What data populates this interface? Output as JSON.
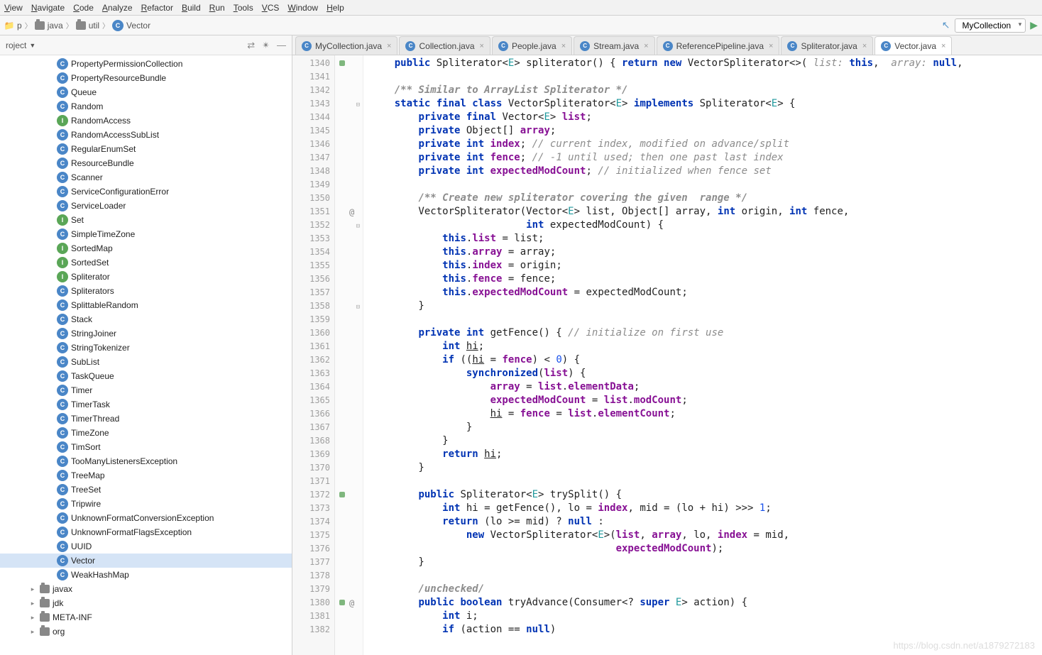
{
  "menu": [
    "View",
    "Navigate",
    "Code",
    "Analyze",
    "Refactor",
    "Build",
    "Run",
    "Tools",
    "VCS",
    "Window",
    "Help"
  ],
  "breadcrumb": {
    "p": "p",
    "java": "java",
    "util": "util",
    "vector": "Vector"
  },
  "runconfig": "MyCollection",
  "sidebar": {
    "title": "roject"
  },
  "tree": [
    {
      "t": "c",
      "n": "PropertyPermissionCollection"
    },
    {
      "t": "c",
      "n": "PropertyResourceBundle"
    },
    {
      "t": "c",
      "n": "Queue"
    },
    {
      "t": "c",
      "n": "Random"
    },
    {
      "t": "i",
      "n": "RandomAccess"
    },
    {
      "t": "c",
      "n": "RandomAccessSubList"
    },
    {
      "t": "c",
      "n": "RegularEnumSet"
    },
    {
      "t": "c",
      "n": "ResourceBundle"
    },
    {
      "t": "c",
      "n": "Scanner"
    },
    {
      "t": "c",
      "n": "ServiceConfigurationError"
    },
    {
      "t": "c",
      "n": "ServiceLoader"
    },
    {
      "t": "i",
      "n": "Set"
    },
    {
      "t": "c",
      "n": "SimpleTimeZone"
    },
    {
      "t": "i",
      "n": "SortedMap"
    },
    {
      "t": "i",
      "n": "SortedSet"
    },
    {
      "t": "i",
      "n": "Spliterator"
    },
    {
      "t": "c",
      "n": "Spliterators"
    },
    {
      "t": "c",
      "n": "SplittableRandom"
    },
    {
      "t": "c",
      "n": "Stack"
    },
    {
      "t": "c",
      "n": "StringJoiner"
    },
    {
      "t": "c",
      "n": "StringTokenizer"
    },
    {
      "t": "c",
      "n": "SubList"
    },
    {
      "t": "c",
      "n": "TaskQueue"
    },
    {
      "t": "c",
      "n": "Timer"
    },
    {
      "t": "c",
      "n": "TimerTask"
    },
    {
      "t": "c",
      "n": "TimerThread"
    },
    {
      "t": "c",
      "n": "TimeZone"
    },
    {
      "t": "c",
      "n": "TimSort"
    },
    {
      "t": "c",
      "n": "TooManyListenersException"
    },
    {
      "t": "c",
      "n": "TreeMap"
    },
    {
      "t": "c",
      "n": "TreeSet"
    },
    {
      "t": "c",
      "n": "Tripwire"
    },
    {
      "t": "c",
      "n": "UnknownFormatConversionException"
    },
    {
      "t": "c",
      "n": "UnknownFormatFlagsException"
    },
    {
      "t": "c",
      "n": "UUID"
    },
    {
      "t": "c",
      "n": "Vector",
      "sel": true
    },
    {
      "t": "c",
      "n": "WeakHashMap"
    }
  ],
  "pkgs": [
    "javax",
    "jdk",
    "META-INF",
    "org"
  ],
  "tabs": [
    {
      "n": "MyCollection.java",
      "a": false
    },
    {
      "n": "Collection.java",
      "a": false
    },
    {
      "n": "People.java",
      "a": false
    },
    {
      "n": "Stream.java",
      "a": false
    },
    {
      "n": "ReferencePipeline.java",
      "a": false
    },
    {
      "n": "Spliterator.java",
      "a": false
    },
    {
      "n": "Vector.java",
      "a": true
    }
  ],
  "startLine": 1340,
  "lines": [
    {
      "m": "g",
      "h": "    <span class='kw'>public</span> Spliterator&lt;<span class='gen'>E</span>&gt; spliterator() { <span class='kw'>return new</span> VectorSpliterator&lt;&gt;( <span class='cm'>list:</span> <span class='kw'>this</span>,  <span class='cm'>array:</span> <span class='kw'>null</span>,"
    },
    {
      "h": ""
    },
    {
      "h": "    <span class='doc'>/** Similar to ArrayList Spliterator */</span>"
    },
    {
      "m": "fold",
      "h": "    <span class='kw'>static final class</span> VectorSpliterator&lt;<span class='gen'>E</span>&gt; <span class='kw'>implements</span> Spliterator&lt;<span class='gen'>E</span>&gt; {"
    },
    {
      "h": "        <span class='kw'>private final</span> Vector&lt;<span class='gen'>E</span>&gt; <span class='fld'>list</span>;"
    },
    {
      "h": "        <span class='kw'>private</span> Object[] <span class='fld'>array</span>;"
    },
    {
      "h": "        <span class='kw'>private int</span> <span class='fld'>index</span>; <span class='cm'>// current index, modified on advance/split</span>"
    },
    {
      "h": "        <span class='kw'>private int</span> <span class='fld'>fence</span>; <span class='cm'>// -1 until used; then one past last index</span>"
    },
    {
      "h": "        <span class='kw'>private int</span> <span class='fld'>expectedModCount</span>; <span class='cm'>// initialized when fence set</span>"
    },
    {
      "h": ""
    },
    {
      "h": "        <span class='doc'>/** Create new spliterator covering the given  range */</span>"
    },
    {
      "m": "at",
      "h": "        VectorSpliterator(Vector&lt;<span class='gen'>E</span>&gt; list, Object[] array, <span class='kw'>int</span> origin, <span class='kw'>int</span> fence,"
    },
    {
      "m": "fold",
      "h": "                          <span class='kw'>int</span> expectedModCount) {"
    },
    {
      "h": "            <span class='kw'>this</span>.<span class='fld'>list</span> = list;"
    },
    {
      "h": "            <span class='kw'>this</span>.<span class='fld'>array</span> = array;"
    },
    {
      "h": "            <span class='kw'>this</span>.<span class='fld'>index</span> = origin;"
    },
    {
      "h": "            <span class='kw'>this</span>.<span class='fld'>fence</span> = fence;"
    },
    {
      "h": "            <span class='kw'>this</span>.<span class='fld'>expectedModCount</span> = expectedModCount;"
    },
    {
      "m": "fold",
      "h": "        }"
    },
    {
      "h": ""
    },
    {
      "h": "        <span class='kw'>private int</span> getFence() { <span class='cm'>// initialize on first use</span>"
    },
    {
      "h": "            <span class='kw'>int</span> <span class='under'>hi</span>;"
    },
    {
      "h": "            <span class='kw'>if</span> ((<span class='under'>hi</span> = <span class='fld'>fence</span>) &lt; <span class='num'>0</span>) {"
    },
    {
      "h": "                <span class='kw'>synchronized</span>(<span class='fld'>list</span>) {"
    },
    {
      "h": "                    <span class='fld'>array</span> = <span class='fld'>list</span>.<span class='fld'>elementData</span>;"
    },
    {
      "h": "                    <span class='fld'>expectedModCount</span> = <span class='fld'>list</span>.<span class='fld'>modCount</span>;"
    },
    {
      "h": "                    <span class='under'>hi</span> = <span class='fld'>fence</span> = <span class='fld'>list</span>.<span class='fld'>elementCount</span>;"
    },
    {
      "h": "                }"
    },
    {
      "h": "            }"
    },
    {
      "h": "            <span class='kw'>return</span> <span class='under'>hi</span>;"
    },
    {
      "h": "        }"
    },
    {
      "h": ""
    },
    {
      "m": "g",
      "h": "        <span class='kw'>public</span> Spliterator&lt;<span class='gen'>E</span>&gt; trySplit() {"
    },
    {
      "h": "            <span class='kw'>int</span> hi = getFence(), lo = <span class='fld'>index</span>, mid = (lo + hi) &gt;&gt;&gt; <span class='num'>1</span>;"
    },
    {
      "h": "            <span class='kw'>return</span> (lo &gt;= mid) ? <span class='kw'>null</span> :"
    },
    {
      "h": "                <span class='kw'>new</span> VectorSpliterator&lt;<span class='gen'>E</span>&gt;(<span class='fld'>list</span>, <span class='fld'>array</span>, lo, <span class='fld'>index</span> = mid,"
    },
    {
      "h": "                                         <span class='fld'>expectedModCount</span>);"
    },
    {
      "h": "        }"
    },
    {
      "h": ""
    },
    {
      "h": "        <span class='doc'>/unchecked/</span>"
    },
    {
      "m": "gat",
      "h": "        <span class='kw'>public boolean</span> tryAdvance(Consumer&lt;? <span class='kw'>super</span> <span class='gen'>E</span>&gt; action) {"
    },
    {
      "h": "            <span class='kw'>int</span> i;"
    },
    {
      "h": "            <span class='kw'>if</span> (action == <span class='kw'>null</span>)"
    }
  ],
  "watermark": "https://blog.csdn.net/a1879272183"
}
